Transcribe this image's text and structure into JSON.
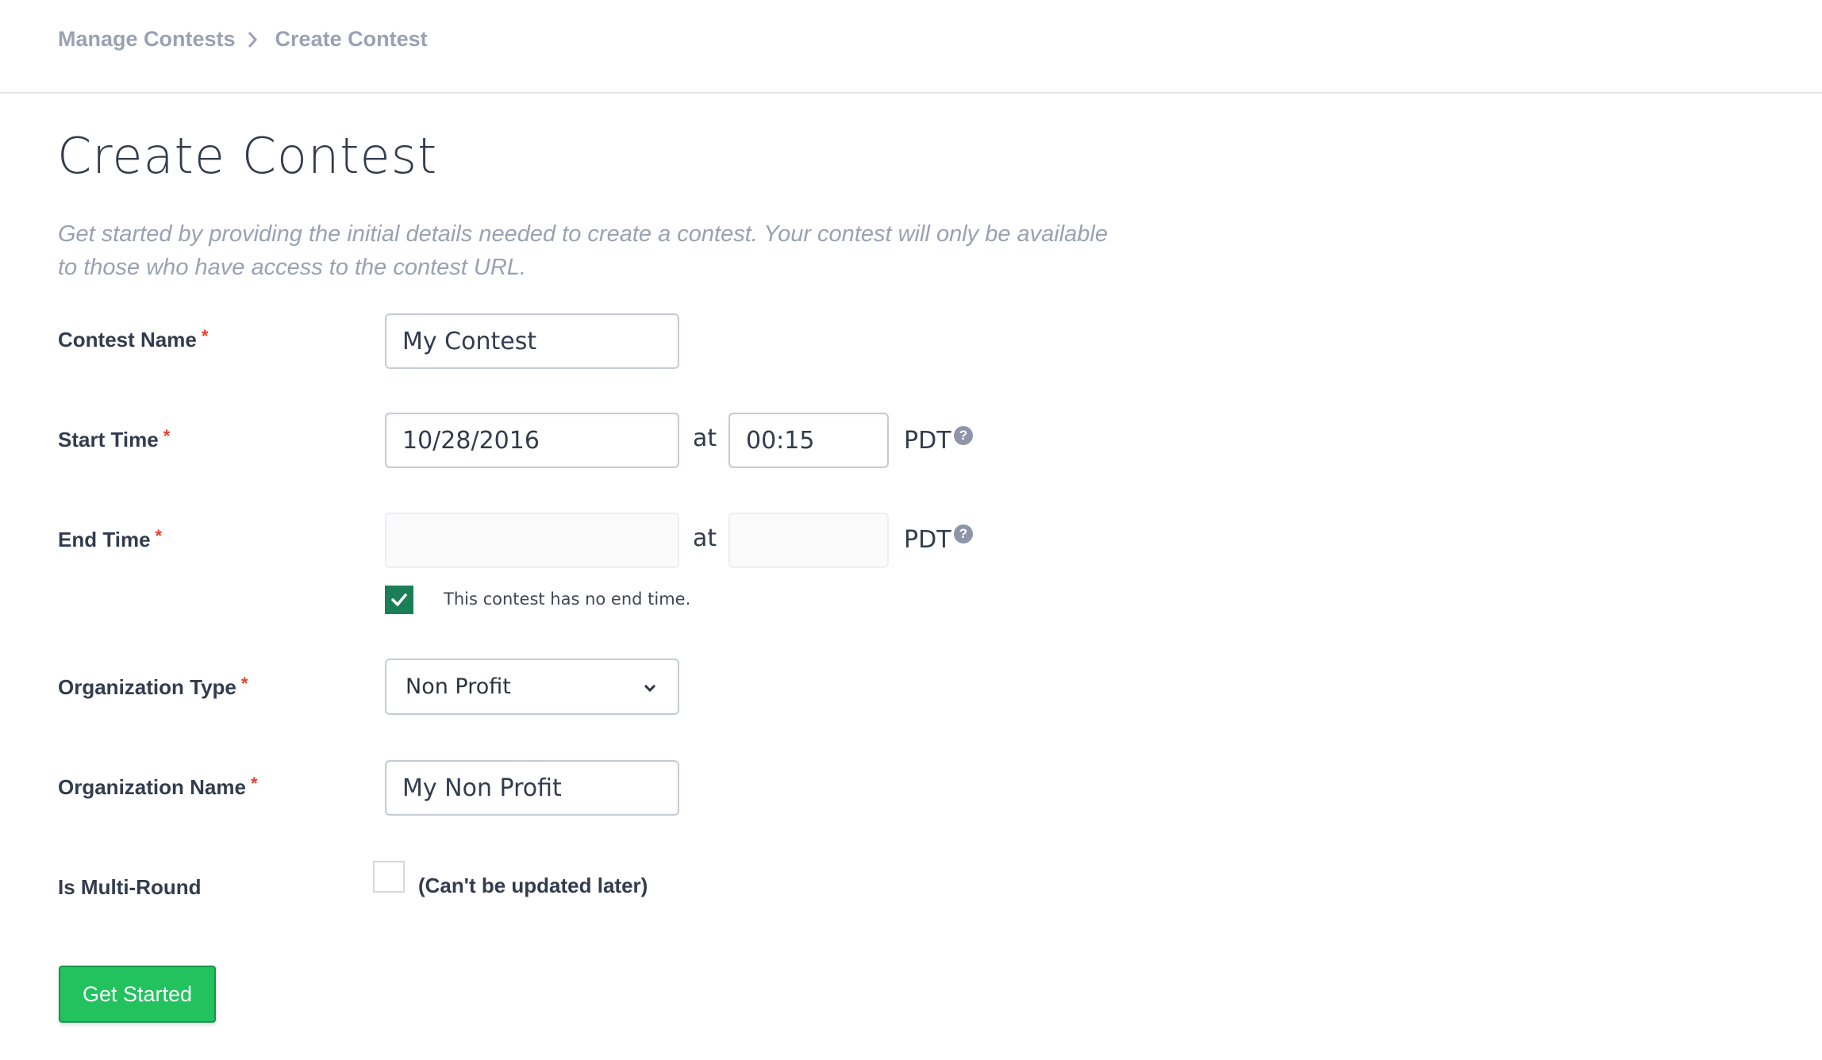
{
  "breadcrumb": {
    "items": [
      "Manage Contests",
      "Create Contest"
    ],
    "separator_icon": "chevron-right-icon"
  },
  "page": {
    "title": "Create Contest",
    "description": "Get started by providing the initial details needed to create a contest. Your contest will only be available to those who have access to the contest URL."
  },
  "form": {
    "required_mark": "*",
    "contest_name": {
      "label": "Contest Name",
      "value": "My Contest"
    },
    "start_time": {
      "label": "Start Time",
      "date": "10/28/2016",
      "at": "at",
      "time": "00:15",
      "timezone": "PDT",
      "help_icon": "?"
    },
    "end_time": {
      "label": "End Time",
      "date": "",
      "at": "at",
      "time": "",
      "timezone": "PDT",
      "help_icon": "?",
      "disabled": true
    },
    "no_end_time": {
      "label": "This contest has no end time.",
      "checked": true
    },
    "organization_type": {
      "label": "Organization Type",
      "selected": "Non Profit"
    },
    "organization_name": {
      "label": "Organization Name",
      "value": "My Non Profit"
    },
    "multi_round": {
      "label": "Is Multi-Round",
      "checked": false,
      "note": "(Can't be updated later)"
    },
    "submit_label": "Get Started"
  },
  "colors": {
    "accent_green": "#22c25f",
    "checkbox_green": "#1a7f56",
    "required_red": "#e5412d",
    "muted_text": "#9aa1b3"
  }
}
